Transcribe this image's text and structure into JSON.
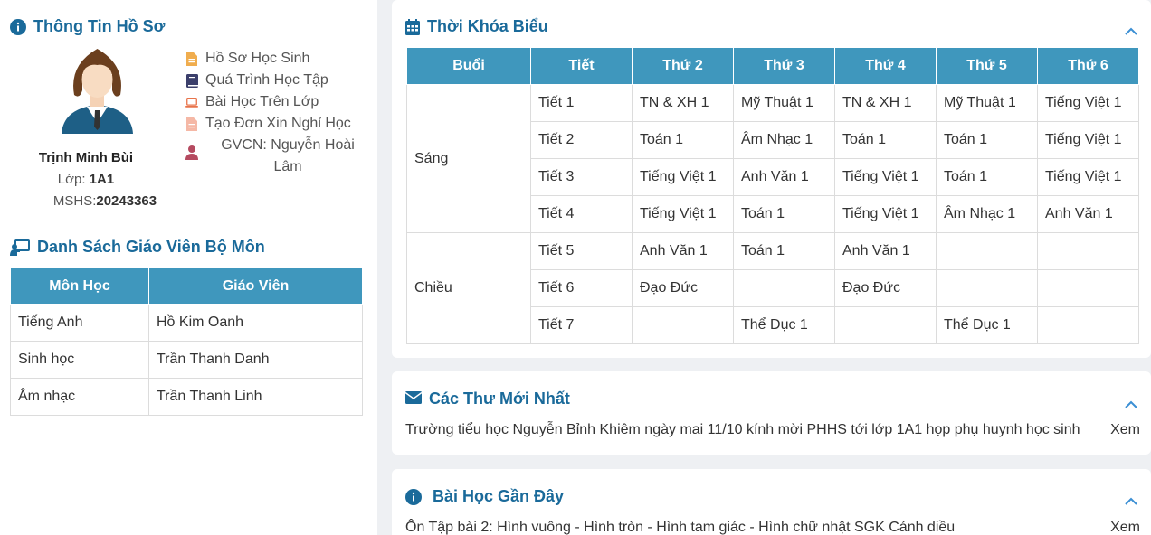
{
  "profile": {
    "title": "Thông Tin Hồ Sơ",
    "name": "Trịnh Minh Bùi",
    "class_label": "Lớp: ",
    "class_value": "1A1",
    "mshs_label": "MSHS:",
    "mshs_value": "20243363",
    "links": [
      {
        "label": "Hồ Sơ Học Sinh",
        "icon": "file-icon"
      },
      {
        "label": "Quá Trình Học Tập",
        "icon": "book-icon"
      },
      {
        "label": "Bài Học Trên Lớp",
        "icon": "laptop-icon"
      },
      {
        "label": "Tạo Đơn Xin Nghỉ Học",
        "icon": "file-icon"
      }
    ],
    "gvcn": "GVCN: Nguyễn Hoài Lâm"
  },
  "teachers": {
    "title": "Danh Sách Giáo Viên Bộ Môn",
    "headers": [
      "Môn Học",
      "Giáo Viên"
    ],
    "rows": [
      [
        "Tiếng Anh",
        "Hồ Kim Oanh"
      ],
      [
        "Sinh học",
        "Trần Thanh Danh"
      ],
      [
        "Âm nhạc",
        "Trần Thanh Linh"
      ]
    ]
  },
  "timetable": {
    "title": "Thời Khóa Biểu",
    "headers": [
      "Buổi",
      "Tiết",
      "Thứ 2",
      "Thứ 3",
      "Thứ 4",
      "Thứ 5",
      "Thứ 6"
    ],
    "sessions": [
      "Sáng",
      "Chiều"
    ],
    "rows": [
      [
        "Tiết 1",
        "TN & XH 1",
        "Mỹ Thuật 1",
        "TN & XH 1",
        "Mỹ Thuật 1",
        "Tiếng Việt 1"
      ],
      [
        "Tiết 2",
        "Toán 1",
        "Âm Nhạc 1",
        "Toán 1",
        "Toán 1",
        "Tiếng Việt 1"
      ],
      [
        "Tiết 3",
        "Tiếng Việt 1",
        "Anh Văn 1",
        "Tiếng Việt 1",
        "Toán 1",
        "Tiếng Việt 1"
      ],
      [
        "Tiết 4",
        "Tiếng Việt 1",
        "Toán 1",
        "Tiếng Việt 1",
        "Âm Nhạc 1",
        "Anh Văn 1"
      ],
      [
        "Tiết 5",
        "Anh Văn 1",
        "Toán 1",
        "Anh Văn 1",
        "",
        ""
      ],
      [
        "Tiết 6",
        "Đạo Đức",
        "",
        "Đạo Đức",
        "",
        ""
      ],
      [
        "Tiết 7",
        "",
        "Thể Dục 1",
        "",
        "Thể Dục 1",
        ""
      ]
    ]
  },
  "letters": {
    "title": "Các Thư Mới Nhất",
    "text": "Trường tiểu học Nguyễn Bỉnh Khiêm ngày mai 11/10 kính mời PHHS tới lớp 1A1 họp phụ huynh học sinh",
    "action": "Xem"
  },
  "lessons": {
    "title": "Bài Học Gần Đây",
    "text": "Ôn Tập bài 2: Hình vuông - Hình tròn - Hình tam giác - Hình chữ nhật SGK Cánh diều",
    "action": "Xem"
  },
  "colors": {
    "accent": "#1a6a9a",
    "header_bg": "#3f97bd"
  }
}
